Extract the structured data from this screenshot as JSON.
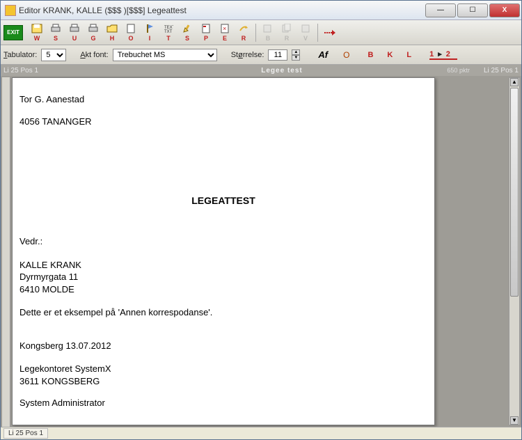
{
  "window": {
    "title": "Editor KRANK, KALLE ($$$ )[$$$] Legeattest"
  },
  "toolbar1": {
    "exit": "EXIT",
    "buttons": [
      {
        "label": "W"
      },
      {
        "label": "S"
      },
      {
        "label": "U"
      },
      {
        "label": "G"
      },
      {
        "label": "H"
      },
      {
        "label": "O"
      },
      {
        "label": "I"
      },
      {
        "label": "T"
      },
      {
        "label": "S"
      },
      {
        "label": "P"
      },
      {
        "label": "E"
      },
      {
        "label": "R"
      }
    ]
  },
  "toolbar2": {
    "tabulator_label": "Tabulator:",
    "tabulator_value": "5",
    "font_label": "Akt font:",
    "font_value": "Trebuchet MS",
    "size_label": "Størrelse:",
    "size_value": "11",
    "af": "Af",
    "o": "O",
    "b": "B",
    "k": "K",
    "l": "L",
    "n1": "1",
    "n2": "2"
  },
  "status_top": {
    "left": "Li 25  Pos 1",
    "center": "Legee test",
    "pktr": "650 pktr",
    "right": "Li 25  Pos 1"
  },
  "document": {
    "recipient_name": "Tor G. Aanestad",
    "recipient_post": "4056 TANANGER",
    "title": "LEGEATTEST",
    "vedr": "Vedr.:",
    "patient_name": "KALLE KRANK",
    "patient_addr": "Dyrmyrgata 11",
    "patient_post": "6410 MOLDE",
    "body": "Dette er et eksempel på 'Annen korrespodanse'.",
    "place_date": "Kongsberg 13.07.2012",
    "office": "Legekontoret SystemX",
    "office_post": "3611 KONGSBERG",
    "signer": "System Administrator"
  },
  "status_bottom": {
    "pos": "Li 25  Pos 1"
  }
}
